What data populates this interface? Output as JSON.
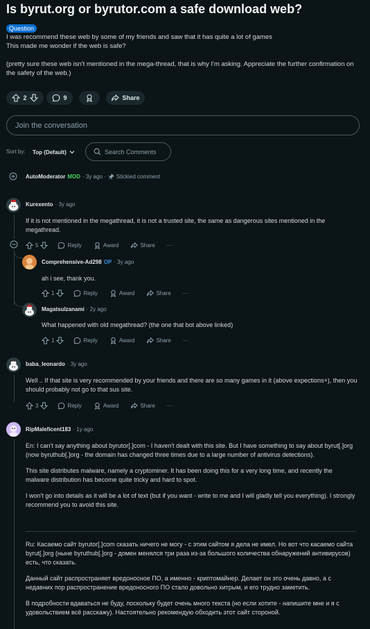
{
  "post": {
    "title": "Is byrut.org or byrutor.com a safe download web?",
    "flair": "Question",
    "line1": "I was recommend these web by some of my friends and saw that it has quite a lot of games",
    "line2": "This made me wonder if the web is safe?",
    "line3": "(pretty sure these web isn't mentioned in the mega-thread, that is why I'm asking. Appreciate the further confirmation on the safety of the web.)",
    "votes": "2",
    "comments": "9",
    "share": "Share"
  },
  "join_placeholder": "Join the conversation",
  "sort": {
    "label": "Sort by:",
    "value": "Top (Default)"
  },
  "search_placeholder": "Search Comments",
  "actions": {
    "reply": "Reply",
    "award": "Award",
    "share": "Share",
    "more": "···"
  },
  "comments": [
    {
      "author": "AutoModerator",
      "badge": "MOD",
      "time": "· 3y ago ·",
      "note": "Stickied comment"
    },
    {
      "author": "Kurexento",
      "time": "· 3y ago",
      "text": "If it is not mentioned in the megathread, it is not a trusted site, the same as dangerous sites mentioned in the megathread.",
      "votes": "5"
    },
    {
      "author": "Comprehensive-Ad298",
      "badge": "OP",
      "time": "· 3y ago",
      "text": "ah i see, thank you.",
      "votes": "1"
    },
    {
      "author": "Magatsulzanami",
      "time": "· 2y ago",
      "text": "What happened with old megathread? (the one that bot above linked)",
      "votes": "1"
    },
    {
      "author": "baba_leonardo",
      "time": "· 3y ago",
      "text": "Well .. If that site is very recommended by your friends and there are so many games in it (above expections+), then you should probably not go to that sus site.",
      "votes": "3"
    },
    {
      "author": "RipMaleficent183",
      "time": "· 1y ago",
      "p1": "En: I can't say anything about byrutor[.]com - I haven't dealt with this site. But I have something to say about byrut[.]org (now byruthub[.]org - the domain has changed three times due to a large number of antivirus detections).",
      "p2": "This site distributes malware, namely a cryptominer. It has been doing this for a very long time, and recently the malware distribution has become quite tricky and hard to spot.",
      "p3": "I won't go into details as it will be a lot of text (but if you want - write to me and I will gladly tell you everything). I strongly recommend you to avoid this site.",
      "p4": "Ru: Касаемо сайт byrutor[.]com сказать ничего не могу - с этим сайтом я дела не имел. Но вот что касаемо сайта byrut[.]org (ныне byruthub[.]org - домен менялся три раза из-за большого количества обнаружений антивирусов) есть, что сказать.",
      "p5": "Данный сайт распространяет вредоносное ПО, а именно - криптомайнер. Делает он это очень давно, а с недавних пор распространение вредоносного ПО стало довольно хитрым, и его трудно заметить.",
      "p6": "В подробности вдаваться не буду, поскольку будет очень много текста (но если хотите - напишите мне и я с удовольствием всё расскажу). Настоятельно рекомендую обходить этот сайт стороной."
    }
  ]
}
